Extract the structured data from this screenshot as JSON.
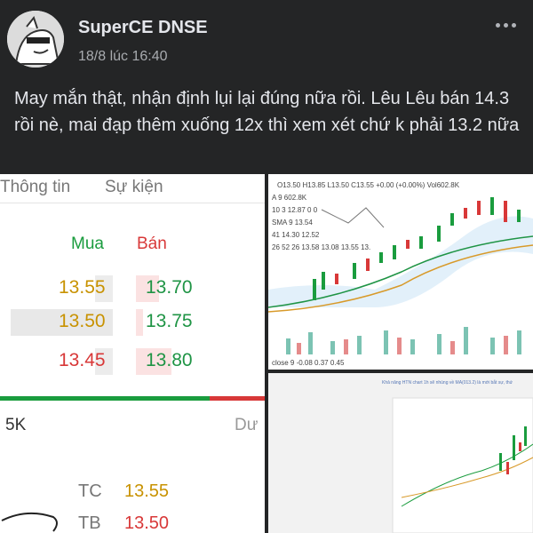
{
  "post": {
    "author": "SuperCE DNSE",
    "timestamp": "18/8 lúc 16:40",
    "text": "May mắn thật, nhận định lụi lại đúng nữa rồi. Lêu Lêu bán 14.3 rồi nè, mai đạp thêm xuống 12x thì xem xét chứ k phải 13.2 nữa"
  },
  "orderbook": {
    "tabs": [
      "Thông tin",
      "Sự kiện"
    ],
    "buy_header": "Mua",
    "sell_header": "Bán",
    "rows": [
      {
        "bid": "13.55",
        "ask": "13.70",
        "bid_color": "#c89200"
      },
      {
        "bid": "13.50",
        "ask": "13.75",
        "bid_color": "#c89200"
      },
      {
        "bid": "13.45",
        "ask": "13.80",
        "bid_color": "#d83838"
      }
    ],
    "volume_label": "5K",
    "right_label": "Dư",
    "ref": [
      {
        "key": "TC",
        "value": "13.55"
      },
      {
        "key": "TB",
        "value": "13.50"
      }
    ]
  },
  "chart_top": {
    "ohlc_text": "O13.50 H13.85 L13.50 C13.55 +0.00 (+0.00%) Vol602.8K",
    "ind1": "A 9   602.8K",
    "ind2": "10 3   12.87   0 0",
    "ind3": "SMA 9   13.54",
    "ind4": "41   14.30   12.52",
    "ind5": "26 52 26   13.58   13.08   13.55   13.",
    "macd": "close 9   -0.08   0.37   0.45"
  },
  "chart_bottom": {
    "caption": "Khả năng HTN chart 1h sẽ nhúng về MA(013.2) là mới bắt sự, thứ"
  },
  "colors": {
    "background": "#242526",
    "buy": "#1a9c3e",
    "sell": "#d83838",
    "ref_yellow": "#c89200"
  }
}
